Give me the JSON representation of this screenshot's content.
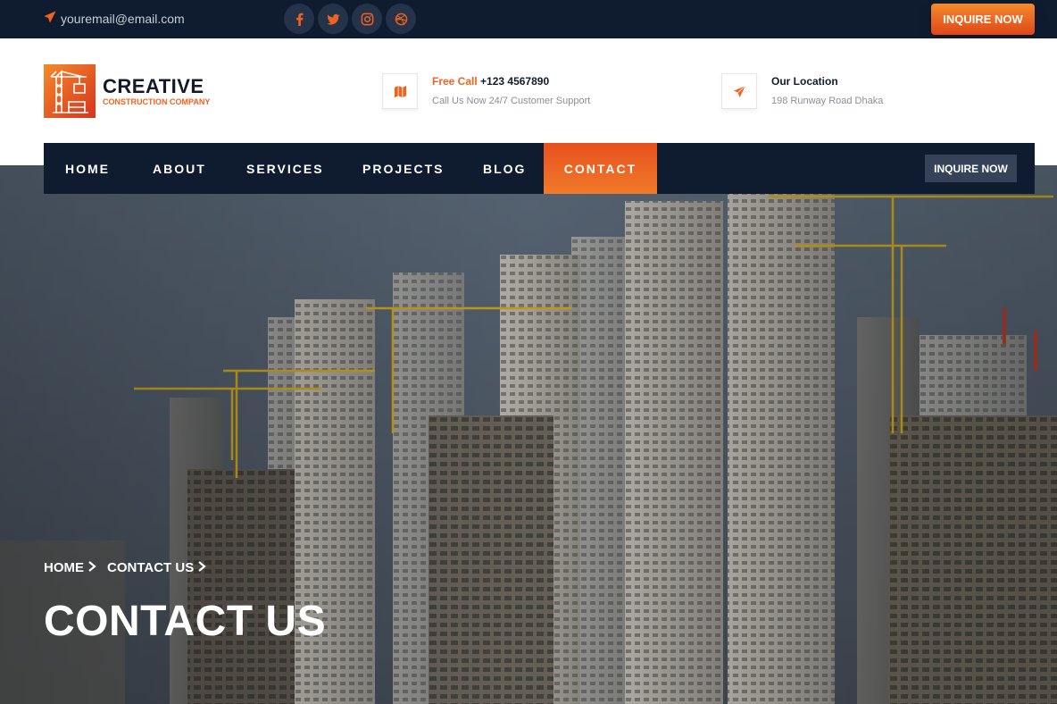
{
  "topbar": {
    "email": "youremail@email.com",
    "inquire_label": "INQUIRE NOW"
  },
  "logo": {
    "title": "CREATIVE",
    "subtitle": "CONSTRUCTION COMPANY"
  },
  "contact_info": {
    "call_accent": "Free Call",
    "call_number": "+123 4567890",
    "call_desc": "Call Us Now 24/7 Customer Support",
    "location_title": "Our Location",
    "location_address": "198 Runway Road Dhaka"
  },
  "nav": {
    "items": [
      {
        "label": "HOME"
      },
      {
        "label": "ABOUT"
      },
      {
        "label": "SERVICES"
      },
      {
        "label": "PROJECTS"
      },
      {
        "label": "BLOG"
      },
      {
        "label": "CONTACT"
      }
    ],
    "active": "CONTACT",
    "inquire_label": "INQUIRE NOW"
  },
  "breadcrumb": {
    "items": [
      {
        "label": "HOME"
      },
      {
        "label": "CONTACT US"
      }
    ]
  },
  "page_title": "CONTACT US",
  "colors": {
    "accent": "#f0621f",
    "navy": "#0f1b2f"
  },
  "icons": {
    "email": "paper-plane-icon",
    "socials": [
      "facebook-icon",
      "twitter-icon",
      "instagram-icon",
      "dribbble-icon"
    ],
    "call": "map-icon",
    "location": "paper-plane-icon"
  }
}
